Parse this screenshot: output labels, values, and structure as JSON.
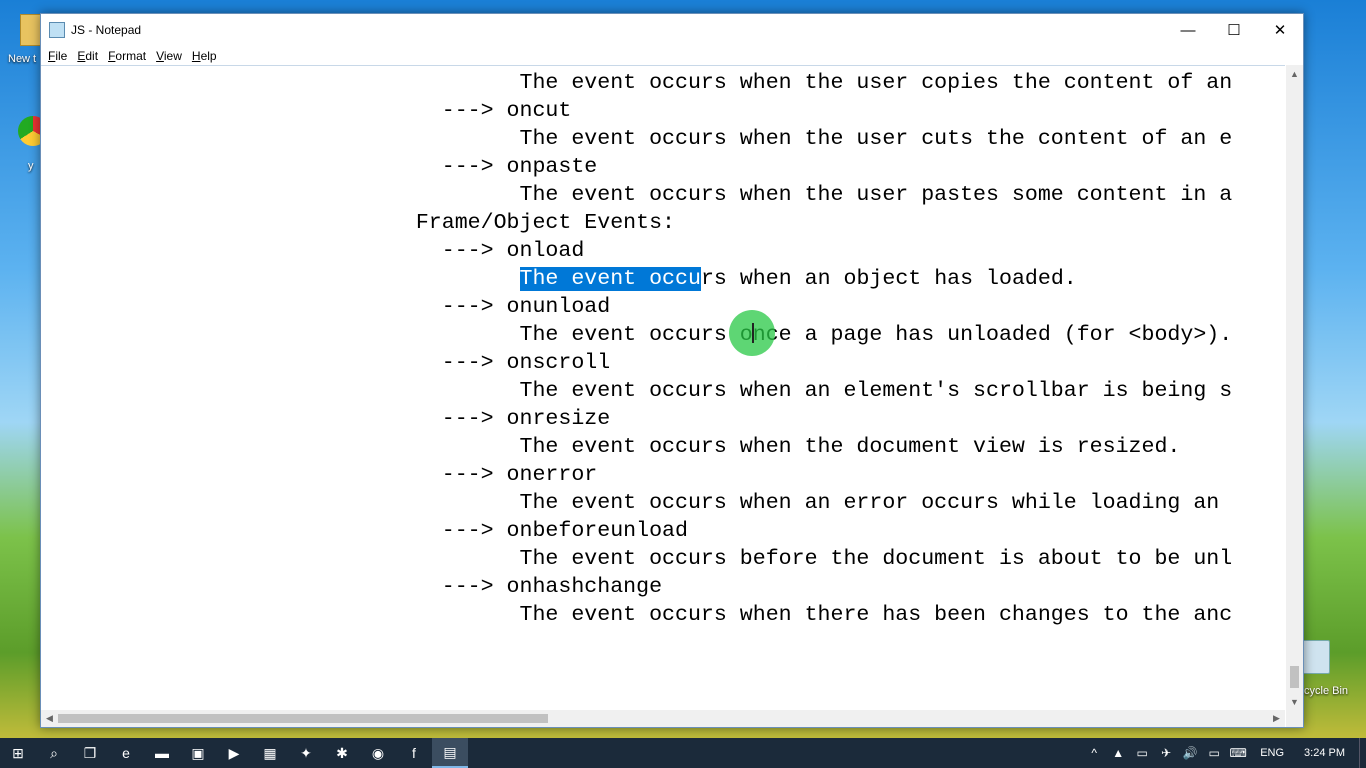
{
  "desktop": {
    "icon_new_folder_label": "New t",
    "icon_chrome_label": "y",
    "icon_recycle_label": "cycle Bin"
  },
  "window": {
    "title": "JS - Notepad",
    "controls": {
      "minimize": "—",
      "maximize": "☐",
      "close": "✕"
    },
    "menu": [
      {
        "label": "File",
        "accel": "F",
        "rest": "ile"
      },
      {
        "label": "Edit",
        "accel": "E",
        "rest": "dit"
      },
      {
        "label": "Format",
        "accel": "F",
        "rest": "ormat"
      },
      {
        "label": "View",
        "accel": "V",
        "rest": "iew"
      },
      {
        "label": "Help",
        "accel": "H",
        "rest": "elp"
      }
    ]
  },
  "editor": {
    "lines": [
      "                                    The event occurs when the user copies the content of an",
      "                              ---> oncut",
      "                                    The event occurs when the user cuts the content of an e",
      "                              ---> onpaste",
      "                                    The event occurs when the user pastes some content in a",
      "                            Frame/Object Events:",
      "                              ---> onload",
      "                                    The event occurs when an object has loaded.",
      "                              ---> onunload",
      "                                    The event occurs once a page has unloaded (for <body>).",
      "                              ---> onscroll",
      "                                    The event occurs when an element's scrollbar is being s",
      "                              ---> onresize",
      "                                    The event occurs when the document view is resized.",
      "                              ---> onerror",
      "                                    The event occurs when an error occurs while loading an",
      "                              ---> onbeforeunload",
      "                                    The event occurs before the document is about to be unl",
      "                              ---> onhashchange",
      "                                    The event occurs when there has been changes to the anc"
    ],
    "selected_line_index": 7,
    "selected_prefix": "                                    ",
    "selected_text": "The event occu",
    "selected_suffix": "rs when an object has loaded."
  },
  "taskbar": {
    "buttons": [
      {
        "name": "start-button",
        "glyph": "⊞"
      },
      {
        "name": "search-button",
        "glyph": "⌕"
      },
      {
        "name": "task-view-button",
        "glyph": "❐"
      },
      {
        "name": "edge-button",
        "glyph": "e"
      },
      {
        "name": "file-explorer-button",
        "glyph": "▬"
      },
      {
        "name": "store-button",
        "glyph": "▣"
      },
      {
        "name": "media-button",
        "glyph": "▶"
      },
      {
        "name": "film-button",
        "glyph": "▦"
      },
      {
        "name": "fox-app-button",
        "glyph": "✦"
      },
      {
        "name": "paint-app-button",
        "glyph": "✱"
      },
      {
        "name": "chrome-button",
        "glyph": "◉"
      },
      {
        "name": "facebook-button",
        "glyph": "f"
      },
      {
        "name": "notepad-button",
        "glyph": "▤"
      }
    ],
    "tray": {
      "icons": [
        "^",
        "▲",
        "▭",
        "✈",
        "🔊",
        "▭",
        "⌨"
      ],
      "language": "ENG",
      "time": "3:24 PM"
    }
  }
}
